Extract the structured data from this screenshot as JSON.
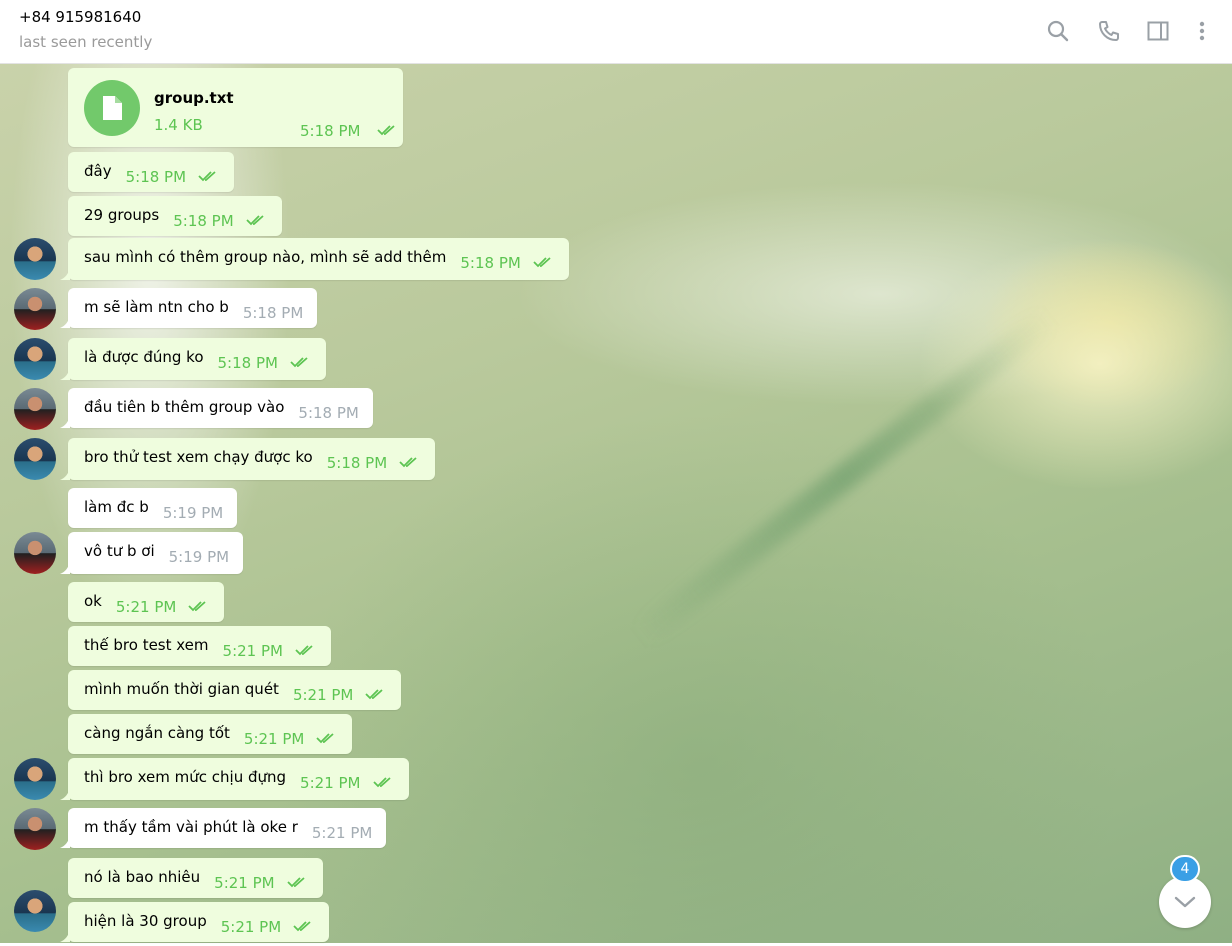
{
  "header": {
    "peer_name": "+84 915981640",
    "status": "last seen recently",
    "icons": [
      "search-icon",
      "phone-icon",
      "sidebar-toggle-icon",
      "more-vert-icon"
    ]
  },
  "file_message": {
    "name": "group.txt",
    "size": "1.4 KB",
    "time": "5:18 PM",
    "icon": "file-icon"
  },
  "messages": [
    {
      "text": "đây",
      "time": "5:18 PM",
      "dir": "out"
    },
    {
      "text": "29 groups",
      "time": "5:18 PM",
      "dir": "out"
    },
    {
      "text": "sau mình có thêm group nào, mình sẽ add thêm",
      "time": "5:18 PM",
      "dir": "out"
    },
    {
      "text": "m sẽ làm ntn cho b",
      "time": "5:18 PM",
      "dir": "in"
    },
    {
      "text": "là được đúng ko",
      "time": "5:18 PM",
      "dir": "out"
    },
    {
      "text": "đầu tiên b thêm group vào",
      "time": "5:18 PM",
      "dir": "in"
    },
    {
      "text": "bro thử test xem chạy được ko",
      "time": "5:18 PM",
      "dir": "out"
    },
    {
      "text": "làm đc b",
      "time": "5:19 PM",
      "dir": "in"
    },
    {
      "text": "vô tư b ơi",
      "time": "5:19 PM",
      "dir": "in"
    },
    {
      "text": "ok",
      "time": "5:21 PM",
      "dir": "out"
    },
    {
      "text": "thế bro test xem",
      "time": "5:21 PM",
      "dir": "out"
    },
    {
      "text": "mình muốn thời gian quét",
      "time": "5:21 PM",
      "dir": "out"
    },
    {
      "text": "càng ngắn càng tốt",
      "time": "5:21 PM",
      "dir": "out"
    },
    {
      "text": "thì bro xem mức chịu đựng",
      "time": "5:21 PM",
      "dir": "out"
    },
    {
      "text": "m thấy tầm vài phút là oke r",
      "time": "5:21 PM",
      "dir": "in"
    },
    {
      "text": "nó là bao nhiêu",
      "time": "5:21 PM",
      "dir": "out"
    },
    {
      "text": "hiện là 30 group",
      "time": "5:21 PM",
      "dir": "out"
    }
  ],
  "unread_badge": "4",
  "colors": {
    "outgoing_bubble": "#effdde",
    "incoming_bubble": "#ffffff",
    "outgoing_meta": "#5dc452",
    "incoming_meta": "#a3acb3",
    "file_icon_bg": "#72c96b",
    "badge": "#3a9fe5"
  }
}
